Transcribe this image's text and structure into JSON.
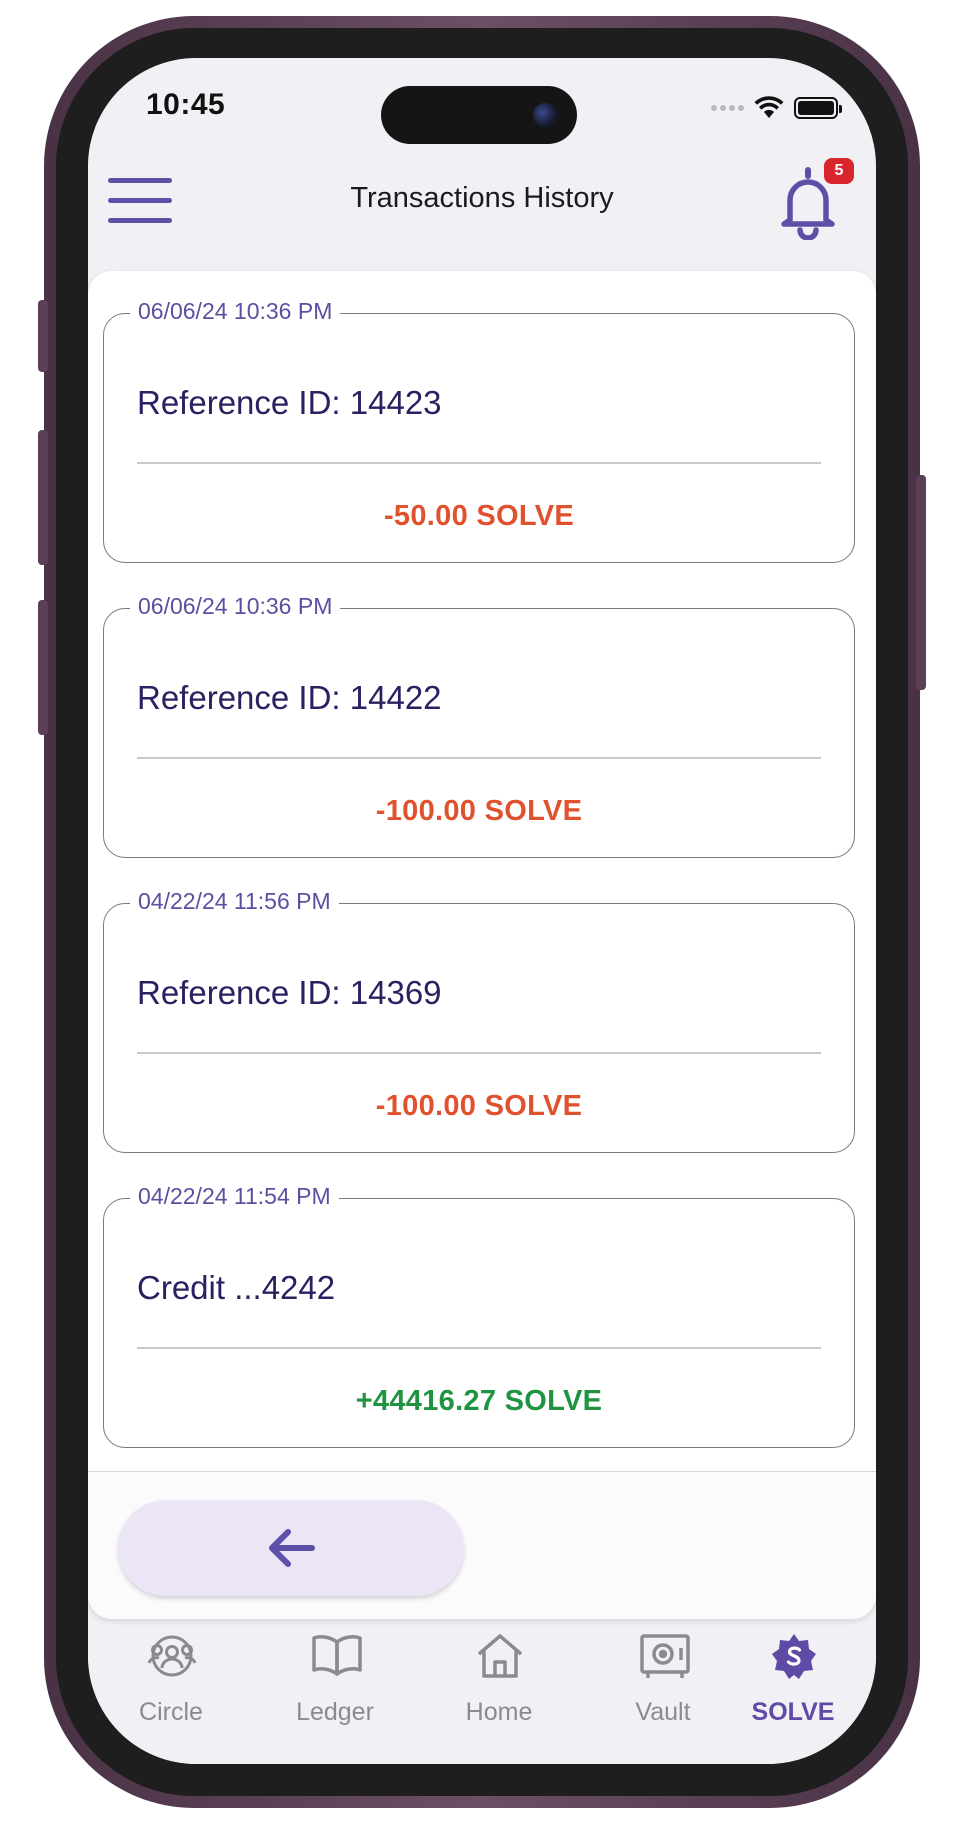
{
  "status_bar": {
    "time": "10:45"
  },
  "header": {
    "title": "Transactions History",
    "notification_count": "5"
  },
  "transactions": [
    {
      "date": "06/06/24 10:36 PM",
      "reference": "Reference ID: 14423",
      "amount": "-50.00 SOLVE"
    },
    {
      "date": "06/06/24 10:36 PM",
      "reference": "Reference ID: 14422",
      "amount": "-100.00 SOLVE"
    },
    {
      "date": "04/22/24 11:56 PM",
      "reference": "Reference ID: 14369",
      "amount": "-100.00 SOLVE"
    },
    {
      "date": "04/22/24 11:54 PM",
      "reference": "Credit ...4242",
      "amount": "+44416.27 SOLVE"
    }
  ],
  "back_button": {
    "icon": "arrow-left-icon"
  },
  "tab_bar": {
    "tabs": [
      {
        "label": "Circle",
        "icon": "people-circle-icon"
      },
      {
        "label": "Ledger",
        "icon": "open-book-icon"
      },
      {
        "label": "Home",
        "icon": "house-icon"
      },
      {
        "label": "Vault",
        "icon": "safe-icon"
      },
      {
        "label": "SOLVE",
        "icon": "solve-badge-icon"
      }
    ],
    "active": "SOLVE"
  },
  "colors": {
    "accent": "#5f4ba6",
    "debit": "#e0512e",
    "credit": "#1f9340",
    "badge": "#d9262c"
  }
}
